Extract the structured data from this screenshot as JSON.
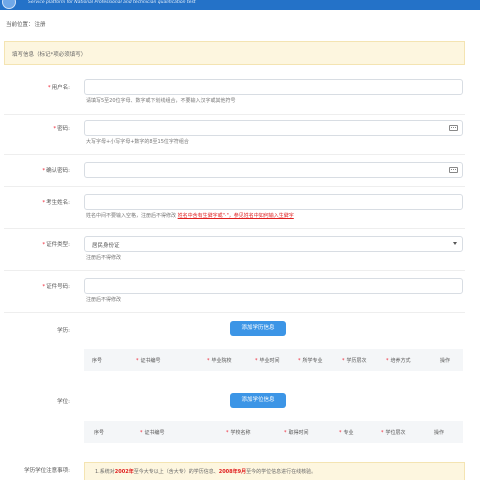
{
  "header": {
    "subtitle": "Service platform for National Professional and technician qualification test"
  },
  "breadcrumb": {
    "prefix": "当前位置：",
    "current": "注册"
  },
  "notice": "填写信息（标记*项必须填写）",
  "form": {
    "username": {
      "label": "用户名:",
      "hint": "请填写5至20位字母、数字或下划线组合，不要输入汉字或其他符号"
    },
    "password": {
      "label": "密码:",
      "hint": "大写字母+小写字母+数字的8至15位字符组合"
    },
    "confirm_password": {
      "label": "确认密码:"
    },
    "name": {
      "label": "考生姓名:",
      "hint": "姓名中间不要输入空格，注册后不得修改",
      "hint_red": "姓名中含有生僻字或\"·\"，参见姓名中如何输入生僻字"
    },
    "id_type": {
      "label": "证件类型:",
      "selected": "居民身份证",
      "hint": "注册后不得修改"
    },
    "id_number": {
      "label": "证件号码:",
      "hint": "注册后不得修改"
    },
    "education": {
      "label": "学历:",
      "button": "添加学历信息",
      "columns": [
        "序号",
        "证书编号",
        "毕业院校",
        "毕业时间",
        "所学专业",
        "学历层次",
        "培养方式",
        "操作"
      ]
    },
    "degree": {
      "label": "学位:",
      "button": "添加学位信息",
      "columns": [
        "序号",
        "证书编号",
        "学校名称",
        "取得时间",
        "专业",
        "学位层次",
        "操作"
      ]
    },
    "notes": {
      "label": "学历学位注意事项:",
      "line_a": "1.系统对",
      "year1": "2002年",
      "line_b": "至今大专以上（含大专）的学历信息、",
      "year2": "2008年9月",
      "line_c": "至今的学位信息进行在线核验。"
    }
  }
}
